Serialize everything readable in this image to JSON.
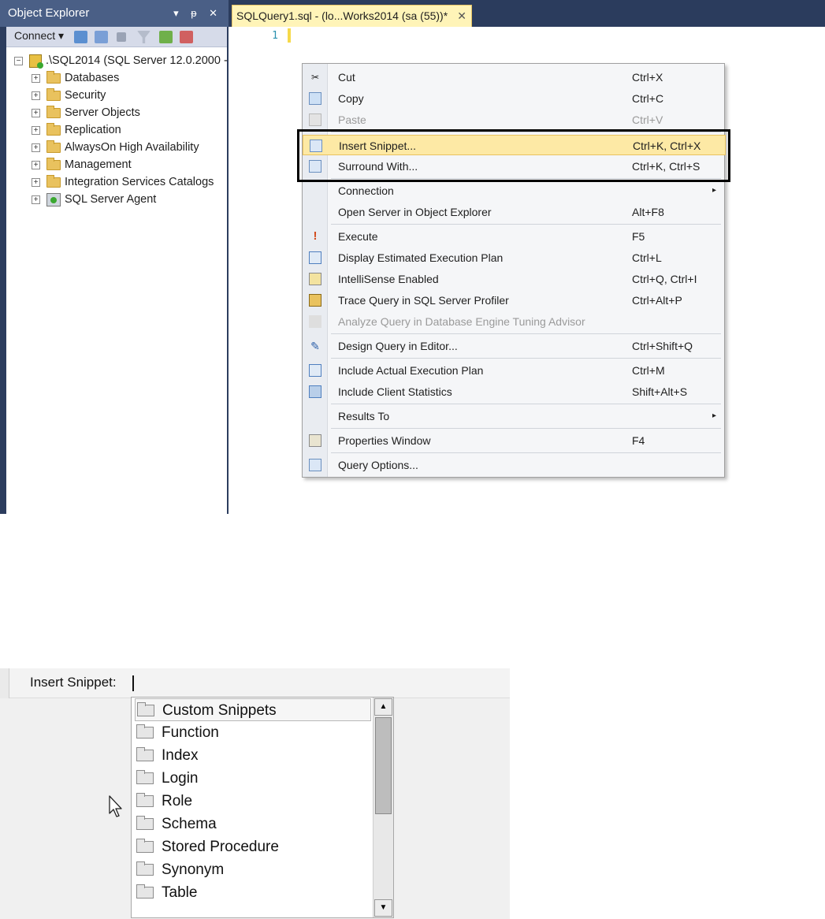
{
  "object_explorer": {
    "title": "Object Explorer",
    "title_controls": "▾ ᵽ ✕",
    "toolbar": {
      "connect_label": "Connect ▾"
    },
    "server_node": ".\\SQL2014 (SQL Server 12.0.2000 -",
    "nodes": [
      {
        "label": "Databases",
        "icon": "folder-icon"
      },
      {
        "label": "Security",
        "icon": "folder-icon"
      },
      {
        "label": "Server Objects",
        "icon": "folder-icon"
      },
      {
        "label": "Replication",
        "icon": "folder-icon"
      },
      {
        "label": "AlwaysOn High Availability",
        "icon": "folder-icon"
      },
      {
        "label": "Management",
        "icon": "folder-icon"
      },
      {
        "label": "Integration Services Catalogs",
        "icon": "folder-icon"
      },
      {
        "label": "SQL Server Agent",
        "icon": "agent-icon"
      }
    ]
  },
  "editor": {
    "tab_title": "SQLQuery1.sql - (lo...Works2014 (sa (55))*",
    "tab_close": "✕",
    "line_number": "1"
  },
  "context_menu": {
    "items": [
      {
        "label": "Cut",
        "shortcut": "Ctrl+X",
        "icon": "scissors-icon"
      },
      {
        "label": "Copy",
        "shortcut": "Ctrl+C",
        "icon": "copy-icon"
      },
      {
        "label": "Paste",
        "shortcut": "Ctrl+V",
        "icon": "paste-icon"
      },
      {
        "label": "Insert Snippet...",
        "shortcut": "Ctrl+K, Ctrl+X",
        "icon": "snippet-icon"
      },
      {
        "label": "Surround With...",
        "shortcut": "Ctrl+K, Ctrl+S",
        "icon": "surround-icon"
      },
      {
        "label": "Connection",
        "shortcut": "",
        "icon": ""
      },
      {
        "label": "Open Server in Object Explorer",
        "shortcut": "Alt+F8",
        "icon": ""
      },
      {
        "label": "Execute",
        "shortcut": "F5",
        "icon": "execute-icon"
      },
      {
        "label": "Display Estimated Execution Plan",
        "shortcut": "Ctrl+L",
        "icon": "estimated-plan-icon"
      },
      {
        "label": "IntelliSense Enabled",
        "shortcut": "Ctrl+Q, Ctrl+I",
        "icon": "intellisense-icon"
      },
      {
        "label": "Trace Query in SQL Server Profiler",
        "shortcut": "Ctrl+Alt+P",
        "icon": "profiler-icon"
      },
      {
        "label": "Analyze Query in Database Engine Tuning Advisor",
        "shortcut": "",
        "icon": "tuning-advisor-icon"
      },
      {
        "label": "Design Query in Editor...",
        "shortcut": "Ctrl+Shift+Q",
        "icon": "design-query-icon"
      },
      {
        "label": "Include Actual Execution Plan",
        "shortcut": "Ctrl+M",
        "icon": "actual-plan-icon"
      },
      {
        "label": "Include Client Statistics",
        "shortcut": "Shift+Alt+S",
        "icon": "client-stats-icon"
      },
      {
        "label": "Results To",
        "shortcut": "",
        "icon": ""
      },
      {
        "label": "Properties Window",
        "shortcut": "F4",
        "icon": "properties-icon"
      },
      {
        "label": "Query Options...",
        "shortcut": "",
        "icon": "query-options-icon"
      }
    ],
    "submenu_arrow": "▸"
  },
  "snippet_picker": {
    "prompt": "Insert Snippet:",
    "items": [
      "Custom Snippets",
      "Function",
      "Index",
      "Login",
      "Role",
      "Schema",
      "Stored Procedure",
      "Synonym",
      "Table"
    ],
    "scroll_up": "▲",
    "scroll_down": "▼"
  }
}
